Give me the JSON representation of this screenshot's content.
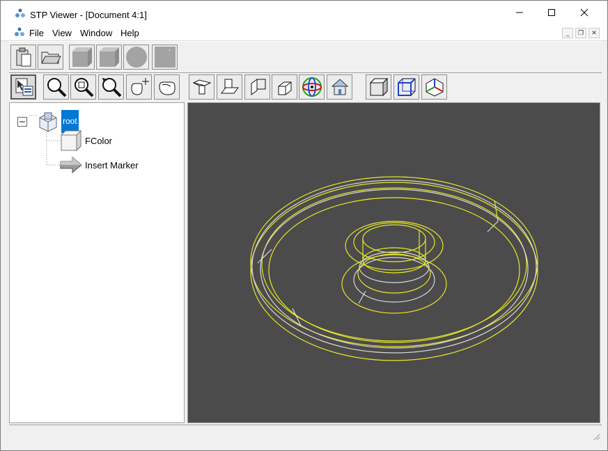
{
  "window": {
    "title": "STP Viewer - [Document 4:1]",
    "minimize_icon": "minimize-icon",
    "maximize_icon": "maximize-icon",
    "close_icon": "close-icon"
  },
  "menu": {
    "items": [
      "File",
      "View",
      "Window",
      "Help"
    ],
    "mdi_controls": [
      "mdi-minimize-icon",
      "mdi-restore-icon",
      "mdi-close-icon"
    ]
  },
  "toolbar_main": {
    "buttons": [
      "paste-icon",
      "open-folder-icon",
      "shaded-box-icon",
      "box-icon",
      "sphere-icon",
      "plane-icon"
    ]
  },
  "toolbar_view": {
    "buttons": [
      "select-tree-icon",
      "zoom-icon",
      "zoom-window-icon",
      "rotate-icon",
      "pan-icon",
      "hand-icon",
      "view-top-icon",
      "view-front-icon",
      "view-side-icon",
      "view-iso-icon",
      "orbit-icon",
      "home-view-icon",
      "shaded-mode-icon",
      "wireframe-mode-icon",
      "axis-triad-icon"
    ]
  },
  "tree": {
    "root_label": "root",
    "children": [
      "FColor",
      "Insert Marker"
    ]
  },
  "colors": {
    "viewport_bg": "#4b4b4b",
    "edge_yellow": "#e8e82a",
    "edge_white": "#d8d8d8",
    "selection": "#0078d7"
  }
}
